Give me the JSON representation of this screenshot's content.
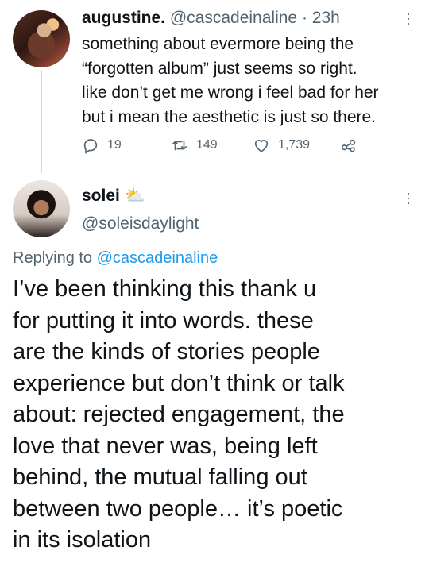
{
  "tweet1": {
    "display_name": "augustine.",
    "handle": "@cascadeinaline",
    "separator": "·",
    "time": "23h",
    "text_lines": [
      "something about evermore being the",
      "“forgotten album” just seems so right.",
      "like don’t get me wrong i feel bad for her",
      "but i mean the aesthetic is just so there."
    ],
    "replies": "19",
    "retweets": "149",
    "likes": "1,739"
  },
  "tweet2": {
    "display_name": "solei",
    "name_emoji": "⛅",
    "handle": "@soleisdaylight",
    "replying_prefix": "Replying to",
    "replying_to": "@cascadeinaline",
    "text_lines": [
      "I’ve been thinking this thank u",
      "for putting it into words. these",
      "are the kinds of stories people",
      "experience but don’t think or talk",
      "about: rejected engagement, the",
      "love that never was, being left",
      "behind, the mutual falling out",
      "between two people… it’s poetic",
      "in its isolation"
    ]
  },
  "icons": {
    "reply": "reply-icon",
    "retweet": "retweet-icon",
    "like": "heart-icon",
    "share": "share-icon",
    "more": "more-vertical-icon"
  },
  "colors": {
    "text": "#0f1419",
    "muted": "#536471",
    "link": "#1d9bf0",
    "thread_line": "#cfd9de"
  }
}
